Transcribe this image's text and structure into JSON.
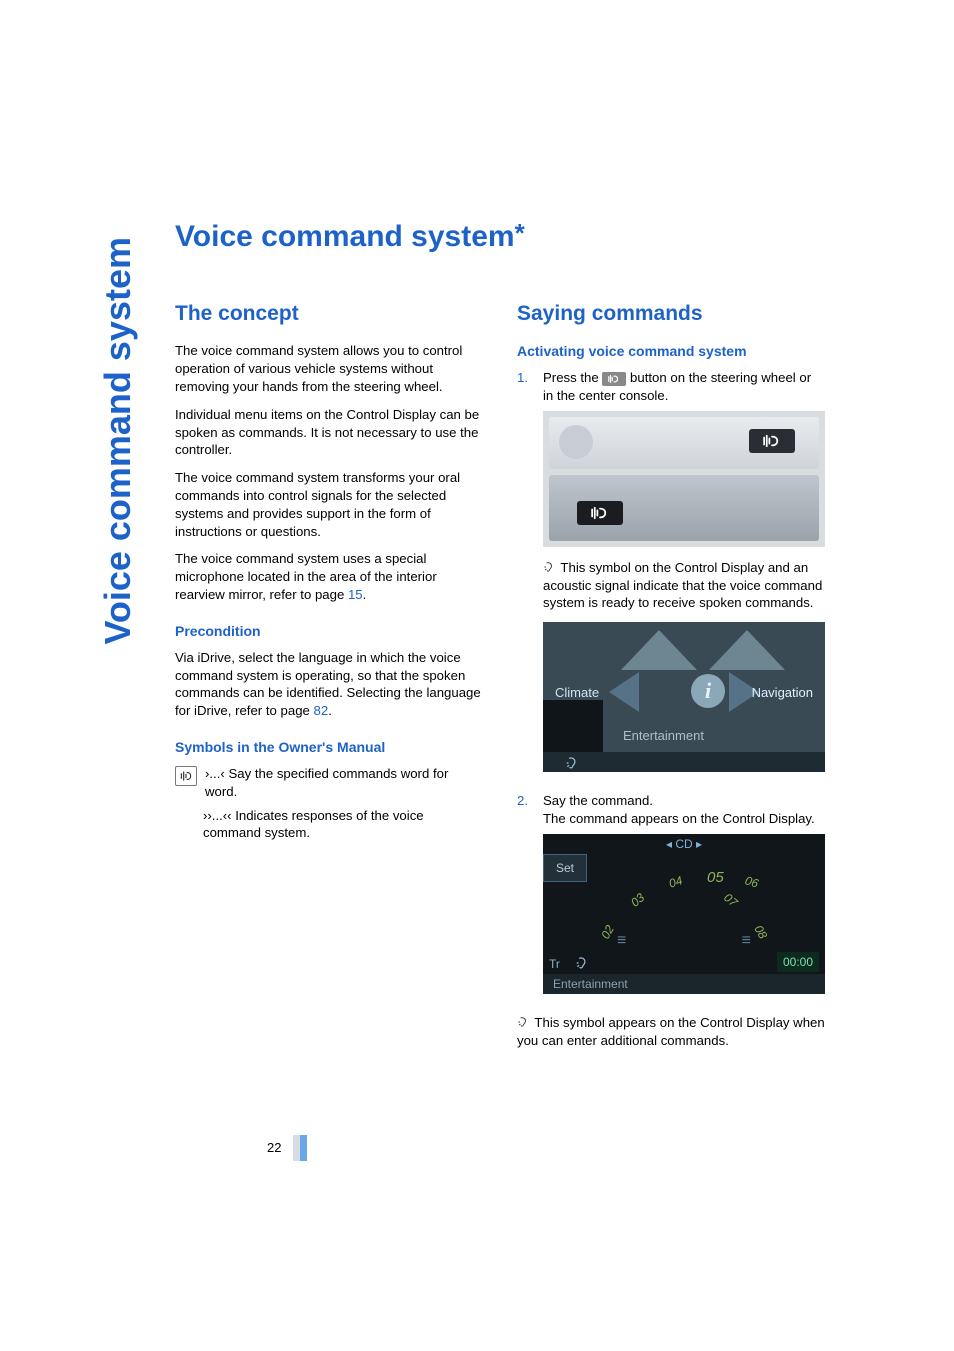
{
  "sideTab": "Voice command system",
  "title": "Voice command system",
  "titleSup": "*",
  "left": {
    "h_concept": "The concept",
    "p1": "The voice command system allows you to control operation of various vehicle systems without removing your hands from the steering wheel.",
    "p2": "Individual menu items on the Control Display can be spoken as commands. It is not necessary to use the controller.",
    "p3": "The voice command system transforms your oral commands into control signals for the selected systems and provides support in the form of instructions or questions.",
    "p4a": "The voice command system uses a special microphone located in the area of the interior rearview mirror, refer to page ",
    "p4link": "15",
    "p4b": ".",
    "h_precond": "Precondition",
    "p5a": "Via iDrive, select the language in which the voice command system is operating, so that the spoken commands can be identified. Selecting the language for iDrive, refer to page ",
    "p5link": "82",
    "p5b": ".",
    "h_symbols": "Symbols in the Owner's Manual",
    "sym1": "›...‹ Say the specified commands word for word.",
    "sym2": "››...‹‹ Indicates responses of the voice command system."
  },
  "right": {
    "h_saying": "Saying commands",
    "h_activating": "Activating voice command system",
    "step1num": "1.",
    "step1a": "Press the ",
    "step1b": " button on the steering wheel or in the center console.",
    "step1note": " This symbol on the Control Display and an acoustic signal indicate that the voice command system is ready to receive spoken commands.",
    "img2": {
      "climate": "Climate",
      "nav": "Navigation",
      "ent": "Entertainment",
      "info": "i"
    },
    "step2num": "2.",
    "step2a": "Say the command.",
    "step2b": "The command appears on the Control Display.",
    "img3": {
      "cd": "◂  CD  ▸",
      "set": "Set",
      "t02": "02",
      "t03": "03",
      "t04": "04",
      "t05": "05",
      "t06": "06",
      "t07": "07",
      "t08": "08",
      "time": "00:00",
      "tr": "Tr",
      "ent": "Entertainment"
    },
    "step2note": " This symbol appears on the Control Display when you can enter additional commands."
  },
  "pageNumber": "22"
}
